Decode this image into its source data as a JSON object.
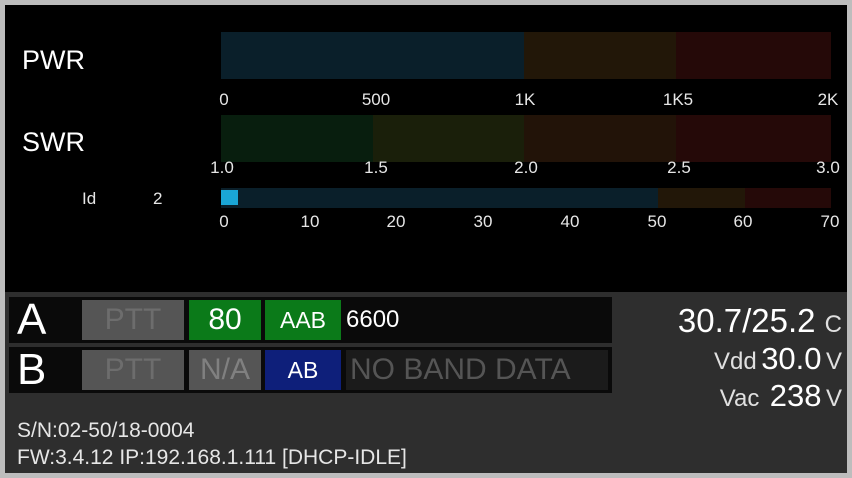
{
  "meters": {
    "pwr": {
      "label": "PWR",
      "ticks": [
        "0",
        "500",
        "1K",
        "1K5",
        "2K"
      ],
      "segment_colors": [
        "#0a1f2a",
        "#221708",
        "#250908"
      ]
    },
    "swr": {
      "label": "SWR",
      "ticks": [
        "1.0",
        "1.5",
        "2.0",
        "2.5",
        "3.0"
      ],
      "segment_colors": [
        "#081e0e",
        "#1a1f0a",
        "#221308",
        "#250908"
      ]
    },
    "id": {
      "label": "Id",
      "value": "2",
      "ticks": [
        "0",
        "10",
        "20",
        "30",
        "40",
        "50",
        "60",
        "70"
      ],
      "indicator_color": "#1aa6d6",
      "segment_colors": [
        "#0a1f2a",
        "#221708",
        "#250908"
      ]
    }
  },
  "status": {
    "row_a": {
      "letter": "A",
      "ptt": "PTT",
      "band": "80",
      "mode": "AAB",
      "freq": "6600",
      "band_color": "#0b7a19"
    },
    "row_b": {
      "letter": "B",
      "ptt": "PTT",
      "band": "N/A",
      "mode": "AB",
      "freq": "NO BAND DATA",
      "mode_color": "#0e1f7a"
    },
    "temperature": {
      "value": "30.7/25.2",
      "unit": "C"
    },
    "vdd": {
      "label": "Vdd",
      "value": "30.0",
      "unit": "V"
    },
    "vac": {
      "label": "Vac",
      "value": "238",
      "unit": "V"
    },
    "serial": "S/N:02-50/18-0004",
    "firmware": "FW:3.4.12  IP:192.168.1.111 [DHCP-IDLE]"
  }
}
